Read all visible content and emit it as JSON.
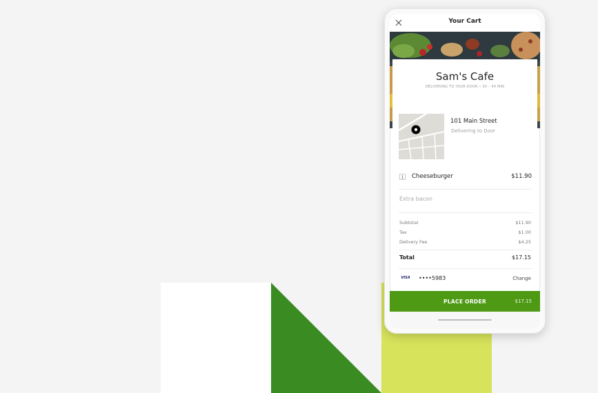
{
  "header": {
    "title": "Your Cart"
  },
  "store": {
    "name": "Sam's Cafe",
    "subtitle": "DELIVERING TO YOUR DOOR • 30 – 40 MIN"
  },
  "delivery": {
    "address": "101 Main Street",
    "method": "Delivering to Door"
  },
  "items": [
    {
      "quantity": "1",
      "name": "Cheeseburger",
      "price": "$11.90",
      "note": "Extra bacon"
    }
  ],
  "summary": {
    "subtotal_label": "Subtotal",
    "subtotal": "$11.90",
    "tax_label": "Tax",
    "tax": "$1.00",
    "delivery_fee_label": "Delivery Fee",
    "delivery_fee": "$4.25",
    "total_label": "Total",
    "total": "$17.15"
  },
  "payment": {
    "brand": "VISA",
    "card_number": "••••5983",
    "change_label": "Change"
  },
  "order_button": {
    "label": "PLACE ORDER",
    "price": "$17.15"
  },
  "colors": {
    "accent_green": "#4f9a15",
    "dark_green": "#3a8c22",
    "lime": "#d7e35b",
    "background": "#f4f4f4"
  }
}
